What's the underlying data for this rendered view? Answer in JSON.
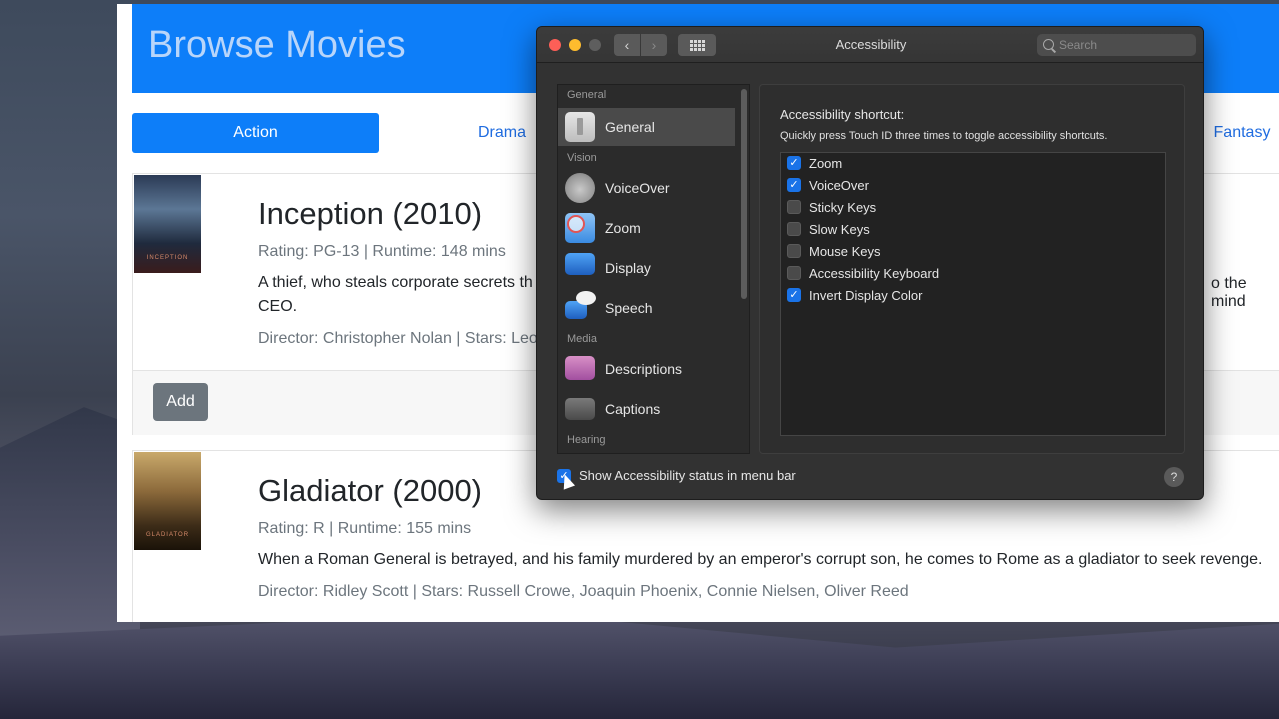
{
  "browser": {
    "site_title": "Browse Movies",
    "tabs": [
      {
        "label": "Action",
        "active": true
      },
      {
        "label": "Drama",
        "active": false
      },
      {
        "label": "Fantasy",
        "active": false
      }
    ],
    "movies": [
      {
        "title": "Inception (2010)",
        "meta": "Rating: PG-13 | Runtime: 148 mins",
        "desc_visible_left": "A thief, who steals corporate secrets th",
        "desc_line2": "CEO.",
        "desc_visible_right": "o the mind",
        "credits_visible": "Director: Christopher Nolan | Stars: Leo",
        "poster_text": "INCEPTION",
        "add_label": "Add"
      },
      {
        "title": "Gladiator (2000)",
        "meta": "Rating: R | Runtime: 155 mins",
        "desc": "When a Roman General is betrayed, and his family murdered by an emperor's corrupt son, he comes to Rome as a gladiator to seek revenge.",
        "credits": "Director: Ridley Scott | Stars: Russell Crowe, Joaquin Phoenix, Connie Nielsen, Oliver Reed",
        "poster_text": "GLADIATOR"
      }
    ]
  },
  "prefs": {
    "title": "Accessibility",
    "search_placeholder": "Search",
    "sidebar": {
      "sections": {
        "general": "General",
        "vision": "Vision",
        "media": "Media",
        "hearing": "Hearing"
      },
      "items": [
        {
          "label": "General",
          "icon": "general-icon",
          "selected": true
        },
        {
          "label": "VoiceOver",
          "icon": "voiceover-icon"
        },
        {
          "label": "Zoom",
          "icon": "zoom-icon"
        },
        {
          "label": "Display",
          "icon": "display-icon"
        },
        {
          "label": "Speech",
          "icon": "speech-icon"
        },
        {
          "label": "Descriptions",
          "icon": "descriptions-icon"
        },
        {
          "label": "Captions",
          "icon": "captions-icon"
        }
      ]
    },
    "shortcut": {
      "title": "Accessibility shortcut:",
      "subtitle": "Quickly press Touch ID three times to toggle accessibility shortcuts.",
      "options": [
        {
          "label": "Zoom",
          "checked": true
        },
        {
          "label": "VoiceOver",
          "checked": true
        },
        {
          "label": "Sticky Keys",
          "checked": false
        },
        {
          "label": "Slow Keys",
          "checked": false
        },
        {
          "label": "Mouse Keys",
          "checked": false
        },
        {
          "label": "Accessibility Keyboard",
          "checked": false
        },
        {
          "label": "Invert Display Color",
          "checked": true
        }
      ]
    },
    "status_label": "Show Accessibility status in menu bar",
    "status_checked": true,
    "help_label": "?"
  }
}
